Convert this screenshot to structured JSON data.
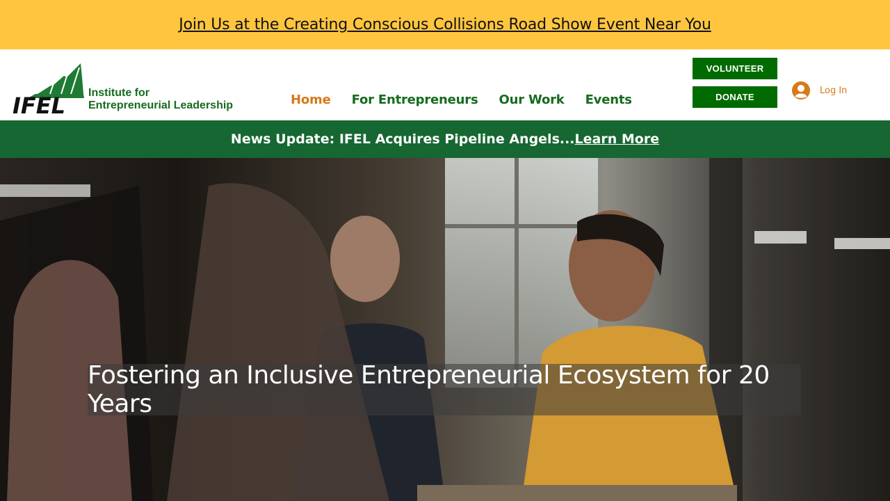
{
  "banner": {
    "text": "Join Us at the Creating Conscious Collisions Road Show Event Near You"
  },
  "logo": {
    "mark": "IFEL",
    "line1": "Institute for",
    "line2": "Entrepreneurial Leadership"
  },
  "nav": {
    "items": [
      {
        "label": "Home",
        "active": true
      },
      {
        "label": "For Entrepreneurs"
      },
      {
        "label": "Our Work"
      },
      {
        "label": "Events"
      }
    ]
  },
  "actions": {
    "volunteer": "VOLUNTEER",
    "donate": "DONATE",
    "login": "Log In"
  },
  "news": {
    "text": "News Update: IFEL Acquires Pipeline Angels...",
    "link": "Learn More"
  },
  "hero": {
    "caption": "Fostering an Inclusive Entrepreneurial Ecosystem for 20 Years"
  },
  "colors": {
    "banner": "#ffc53f",
    "brand_green": "#166b1f",
    "news_green": "#166732",
    "button_green": "#006b00",
    "accent_orange": "#d8791a"
  }
}
